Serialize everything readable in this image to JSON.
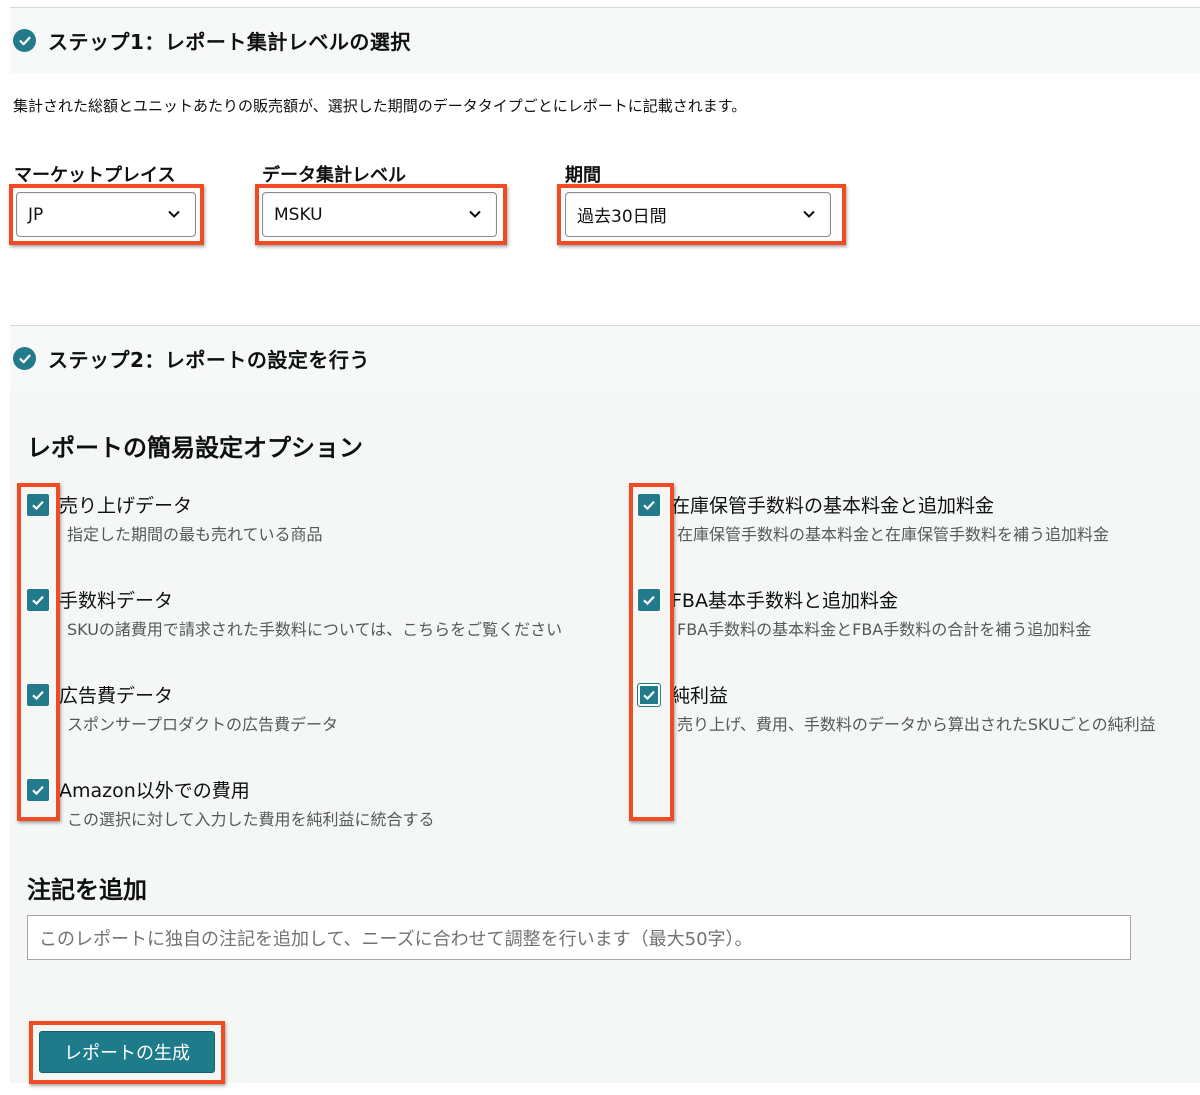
{
  "step1": {
    "title": "ステップ1：レポート集計レベルの選択",
    "description": "集計された総額とユニットあたりの販売額が、選択した期間のデータタイプごとにレポートに記載されます。",
    "fields": [
      {
        "label": "マーケットプレイス",
        "value": "JP"
      },
      {
        "label": "データ集計レベル",
        "value": "MSKU"
      },
      {
        "label": "期間",
        "value": "過去30日間"
      }
    ]
  },
  "step2": {
    "title": "ステップ2：レポートの設定を行う",
    "options_title": "レポートの簡易設定オプション",
    "left_options": [
      {
        "title": "売り上げデータ",
        "desc": "指定した期間の最も売れている商品",
        "checked": true
      },
      {
        "title": "手数料データ",
        "desc": "SKUの諸費用で請求された手数料については、こちらをご覧ください",
        "checked": true
      },
      {
        "title": "広告費データ",
        "desc": "スポンサープロダクトの広告費データ",
        "checked": true
      },
      {
        "title": "Amazon以外での費用",
        "desc": "この選択に対して入力した費用を純利益に統合する",
        "checked": true
      }
    ],
    "right_options": [
      {
        "title": "在庫保管手数料の基本料金と追加料金",
        "desc": "在庫保管手数料の基本料金と在庫保管手数料を補う追加料金",
        "checked": true
      },
      {
        "title": "FBA基本手数料と追加料金",
        "desc": "FBA手数料の基本料金とFBA手数料の合計を補う追加料金",
        "checked": true
      },
      {
        "title": "純利益",
        "desc": "売り上げ、費用、手数料のデータから算出されたSKUごとの純利益",
        "checked": true
      }
    ],
    "note_title": "注記を追加",
    "note_placeholder": "このレポートに独自の注記を追加して、ニーズに合わせて調整を行います（最大50字）。",
    "generate_label": "レポートの生成"
  },
  "colors": {
    "accent": "#227a8a",
    "highlight": "#f04b23",
    "button": "#1d7b8a"
  },
  "icons": {
    "step_check": "check-circle-icon",
    "dropdown": "chevron-down-icon",
    "checkbox": "checkmark-icon"
  }
}
